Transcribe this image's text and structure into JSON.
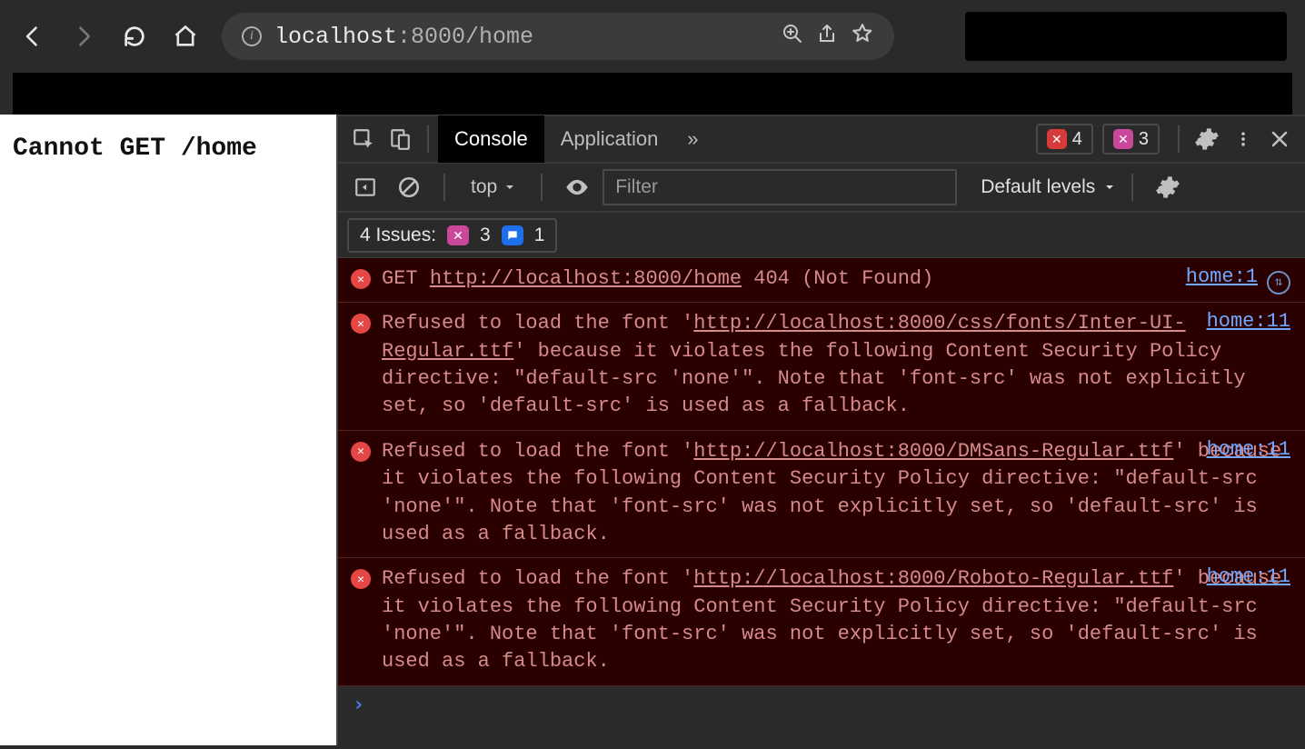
{
  "browser": {
    "url_host": "localhost",
    "url_port": ":8000",
    "url_path": "/home"
  },
  "page": {
    "body_text": "Cannot GET /home"
  },
  "devtools": {
    "tabs": {
      "console": "Console",
      "application": "Application"
    },
    "error_count": "4",
    "issue_badge_count": "3",
    "context_label": "top",
    "filter_placeholder": "Filter",
    "levels_label": "Default levels",
    "issues": {
      "label": "4 Issues:",
      "pink_count": "3",
      "blue_count": "1"
    },
    "messages": [
      {
        "prefix": "GET ",
        "href": "http://localhost:8000/home",
        "suffix": " 404 (Not Found)",
        "source": "home:1",
        "has_sw": true
      },
      {
        "prefix": "Refused to load the font '",
        "href": "http://localhost:8000/css/fonts/Inter-UI-Regular.ttf",
        "suffix": "' because it violates the following Content Security Policy directive: \"default-src 'none'\". Note that 'font-src' was not explicitly set, so 'default-src' is used as a fallback.",
        "source": "home:11",
        "has_sw": false
      },
      {
        "prefix": "Refused to load the font '",
        "href": "http://localhost:8000/DMSans-Regular.ttf",
        "suffix": "' because it violates the following Content Security Policy directive: \"default-src 'none'\". Note that 'font-src' was not explicitly set, so 'default-src' is used as a fallback.",
        "source": "home:11",
        "has_sw": false
      },
      {
        "prefix": "Refused to load the font '",
        "href": "http://localhost:8000/Roboto-Regular.ttf",
        "suffix": "' because it violates the following Content Security Policy directive: \"default-src 'none'\". Note that 'font-src' was not explicitly set, so 'default-src' is used as a fallback.",
        "source": "home:11",
        "has_sw": false
      }
    ],
    "prompt": "›"
  }
}
